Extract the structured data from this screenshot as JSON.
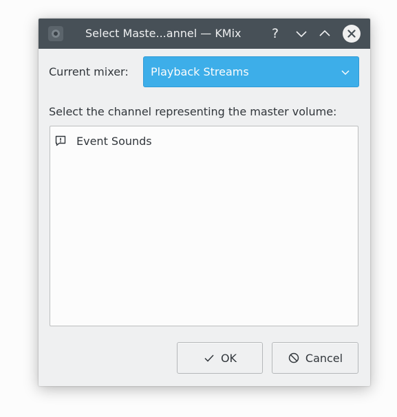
{
  "window": {
    "title": "Select Maste...annel — KMix",
    "help_glyph": "?",
    "buttons": [
      "help-icon",
      "minimize-icon",
      "maximize-icon",
      "close-icon"
    ]
  },
  "mixer": {
    "label": "Current mixer:",
    "selected": "Playback Streams"
  },
  "instruction": "Select the channel representing the master volume:",
  "channels": [
    {
      "label": "Event Sounds",
      "icon": "notification-icon"
    }
  ],
  "actions": {
    "ok_label": "OK",
    "cancel_label": "Cancel"
  },
  "colors": {
    "titlebar": "#475057",
    "accent": "#3daee9",
    "window_bg": "#eff0f1",
    "text": "#31363b"
  }
}
